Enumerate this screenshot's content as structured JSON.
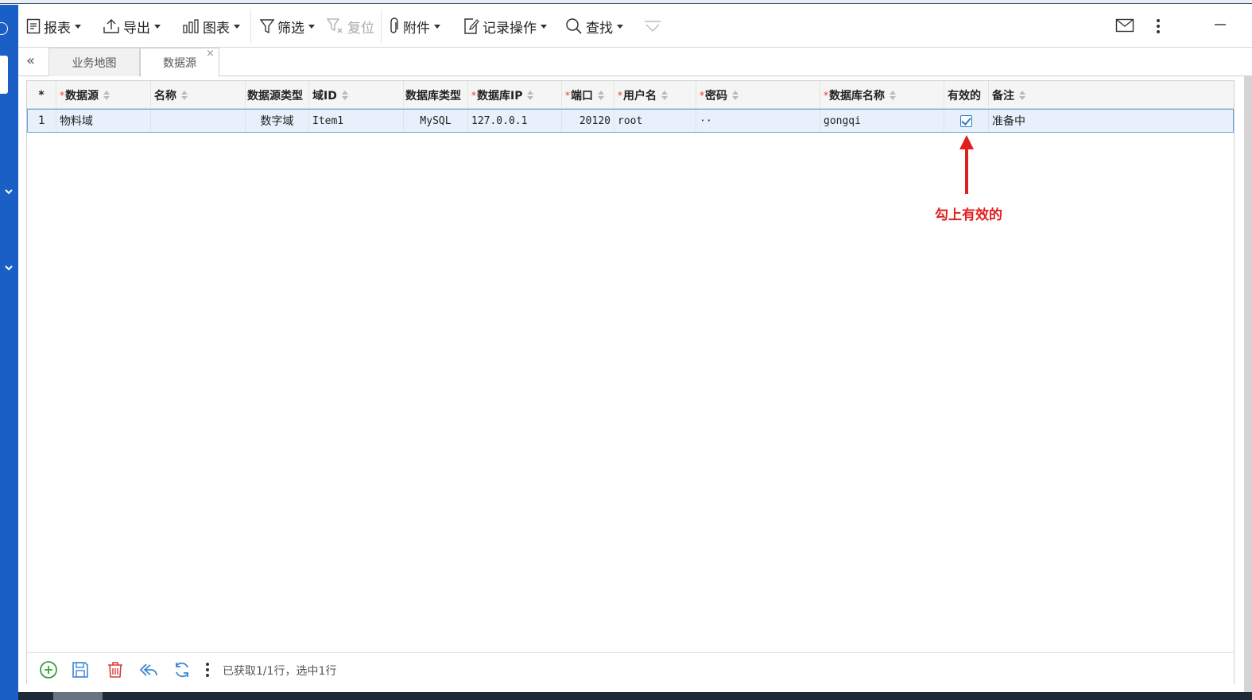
{
  "toolbar": {
    "report": "报表",
    "export": "导出",
    "chart": "图表",
    "filter": "筛选",
    "reset": "复位",
    "attachment": "附件",
    "record_ops": "记录操作",
    "find": "查找"
  },
  "tabs": [
    {
      "label": "业务地图",
      "active": false
    },
    {
      "label": "数据源",
      "active": true
    }
  ],
  "grid": {
    "columns": [
      {
        "label": "*",
        "required": false,
        "sortable": false
      },
      {
        "label": "数据源",
        "required": true,
        "sortable": true
      },
      {
        "label": "名称",
        "required": false,
        "sortable": true
      },
      {
        "label": "数据源类型",
        "required": false,
        "sortable": false
      },
      {
        "label": "域ID",
        "required": false,
        "sortable": true
      },
      {
        "label": "数据库类型",
        "required": false,
        "sortable": false
      },
      {
        "label": "数据库IP",
        "required": true,
        "sortable": true
      },
      {
        "label": "端口",
        "required": true,
        "sortable": true
      },
      {
        "label": "用户名",
        "required": true,
        "sortable": true
      },
      {
        "label": "密码",
        "required": true,
        "sortable": true
      },
      {
        "label": "数据库名称",
        "required": true,
        "sortable": true
      },
      {
        "label": "有效的",
        "required": false,
        "sortable": false
      },
      {
        "label": "备注",
        "required": false,
        "sortable": true
      }
    ],
    "rows": [
      {
        "num": "1",
        "datasource": "物料域",
        "name": "",
        "ds_type": "数字域",
        "domain_id": "Item1",
        "db_type": "MySQL",
        "db_ip": "127.0.0.1",
        "port": "20120",
        "username": "root",
        "password": "··",
        "db_name": "gongqi",
        "valid": true,
        "remark": "准备中"
      }
    ]
  },
  "annotation": {
    "text": "勾上有效的",
    "color": "#e0201f"
  },
  "footer": {
    "status": "已获取1/1行，选中1行"
  },
  "colors": {
    "accent": "#1a5fc6",
    "selected_row": "#e8f1fb",
    "required_mark": "#e53935"
  }
}
